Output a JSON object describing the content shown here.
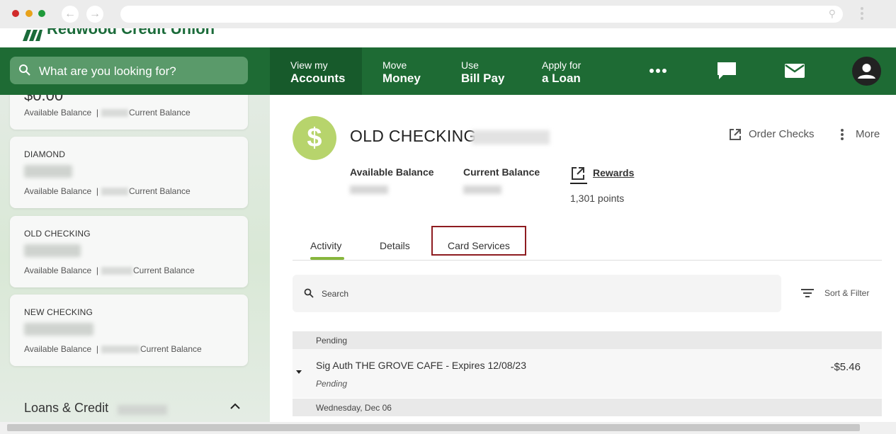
{
  "browser": {
    "window_dots": [
      {
        "name": "close",
        "color": "#d12b2b"
      },
      {
        "name": "minimize",
        "color": "#e8a21a"
      },
      {
        "name": "maximize",
        "color": "#1f9a3a"
      }
    ]
  },
  "brand": {
    "name": "Redwood Credit Union",
    "primary_color": "#1e6b34",
    "accent_color": "#87b63c"
  },
  "topnav": {
    "search_placeholder": "What are you looking for?",
    "items": [
      {
        "line1": "View my",
        "line2": "Accounts",
        "active": true
      },
      {
        "line1": "Move",
        "line2": "Money"
      },
      {
        "line1": "Use",
        "line2": "Bill Pay"
      },
      {
        "line1": "Apply for",
        "line2": "a Loan"
      }
    ],
    "icons": [
      "more-horizontal-icon",
      "chat-icon",
      "mail-icon",
      "profile-icon"
    ]
  },
  "sidebar": {
    "first_card_amount": "$0.00",
    "accounts": [
      {
        "name": "DIAMOND",
        "available_label": "Available Balance",
        "current_label": "Current Balance"
      },
      {
        "name": "OLD CHECKING",
        "available_label": "Available Balance",
        "current_label": "Current Balance"
      },
      {
        "name": "NEW CHECKING",
        "available_label": "Available Balance",
        "current_label": "Current Balance"
      }
    ],
    "first_card_available_label": "Available Balance",
    "first_card_current_label": "Current Balance",
    "loans_section": "Loans & Credit"
  },
  "account": {
    "title": "OLD CHECKING",
    "order_checks": "Order Checks",
    "more": "More",
    "available_balance_label": "Available Balance",
    "current_balance_label": "Current Balance",
    "rewards_label": "Rewards",
    "points": "1,301 points"
  },
  "tabs": [
    {
      "label": "Activity",
      "selected": true
    },
    {
      "label": "Details"
    },
    {
      "label": "Card Services",
      "highlighted": true
    }
  ],
  "transactions": {
    "search_placeholder": "Search",
    "sort_filter": "Sort & Filter",
    "pending_header": "Pending",
    "rows": [
      {
        "description": "Sig Auth THE GROVE CAFE - Expires 12/08/23",
        "status": "Pending",
        "amount": "-$5.46"
      }
    ],
    "date_header": "Wednesday, Dec 06"
  }
}
